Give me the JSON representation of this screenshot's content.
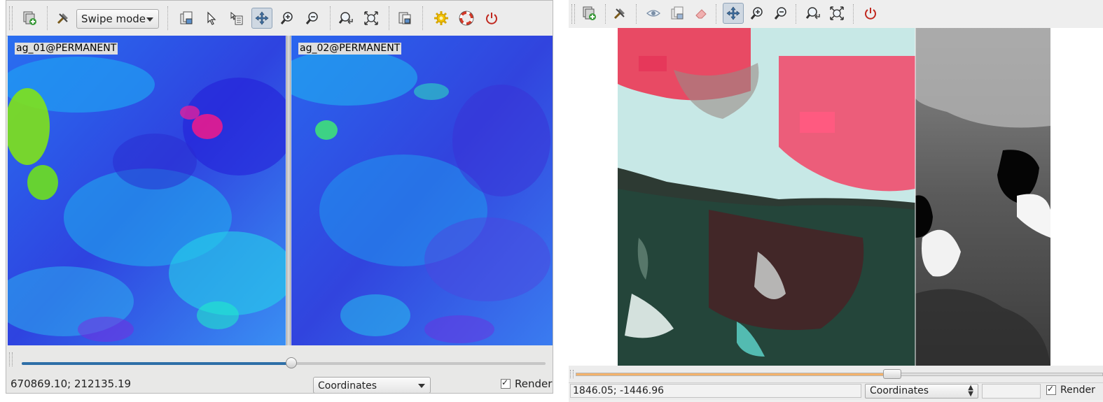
{
  "left_window": {
    "toolbar": {
      "mode_select": {
        "value": "Swipe mode"
      },
      "icons": [
        "add-map-layers-icon",
        "tools-icon",
        "add-layer-icon",
        "pointer-icon",
        "query-icon",
        "pan-icon",
        "zoom-in-icon",
        "zoom-out-icon",
        "zoom-back-icon",
        "zoom-extent-icon",
        "layer-settings-icon",
        "settings-icon",
        "help-icon",
        "quit-icon"
      ]
    },
    "map_left_label": "ag_01@PERMANENT",
    "map_right_label": "ag_02@PERMANENT",
    "slider_value": 0.515,
    "status": {
      "coordinates": "670869.10; 212135.19",
      "mode_select": "Coordinates",
      "render_label": "Render",
      "render_checked": true
    }
  },
  "right_window": {
    "toolbar": {
      "icons": [
        "add-map-layers-icon",
        "tools-icon",
        "show-icon",
        "add-layer-icon",
        "eraser-icon",
        "pan-icon",
        "zoom-in-icon",
        "zoom-out-icon",
        "zoom-back-icon",
        "zoom-extent-icon",
        "quit-icon"
      ]
    },
    "slider_value": 0.6,
    "status": {
      "coordinates": "1846.05; -1446.96",
      "mode_select": "Coordinates",
      "render_label": "Render",
      "render_checked": true
    }
  },
  "colors": {
    "active_button": "#cfd8e2",
    "slider_fill_left": "#2e6fa7",
    "slider_fill_right": "#f3b26b"
  }
}
